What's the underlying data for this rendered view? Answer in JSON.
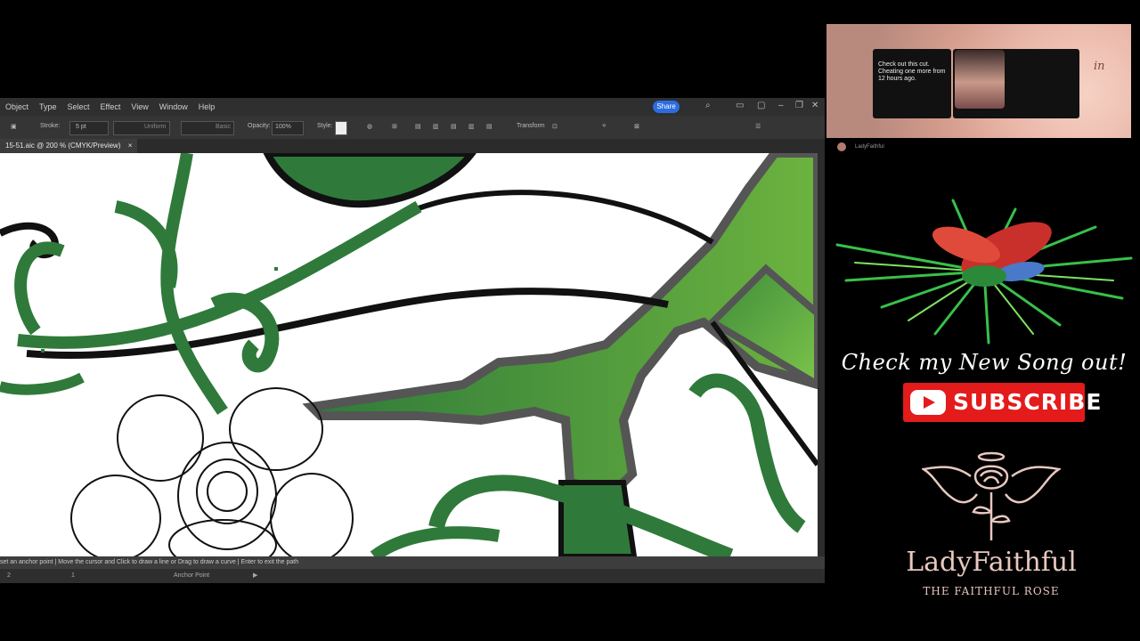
{
  "menu": {
    "items": [
      "Object",
      "Type",
      "Select",
      "Effect",
      "View",
      "Window",
      "Help"
    ],
    "share_label": "Share"
  },
  "control_bar": {
    "stroke_label": "Stroke:",
    "stroke_value": "5 pt",
    "profile_value": "Uniform",
    "brush_value": "Basic",
    "opacity_label": "Opacity:",
    "opacity_value": "100%",
    "style_label": "Style:",
    "transform_label": "Transform"
  },
  "document_tab": {
    "title": "15-51.aic @ 200 % (CMYK/Preview)",
    "close": "×"
  },
  "status_bar": {
    "hint": "set an anchor point  |  Move the cursor and Click to draw a line or Drag to draw a curve  |  Enter to exit the path"
  },
  "bottom_bar": {
    "zoom": "2",
    "page": "1",
    "tool": "Anchor Point"
  },
  "webcam": {
    "pv_text": "Check out this cut.\nCheating one more from 12 hours ago.",
    "owner_name": "LadyFaithful",
    "corner_text": "in"
  },
  "promo": {
    "headline": "Check my New Song out!",
    "subscribe": "SUBSCRIBE",
    "brand": "LadyFaithful",
    "tagline": "THE FAITHFUL ROSE"
  },
  "colors": {
    "green_dark": "#2f7a3a",
    "green_light": "#6cb33f",
    "youtube_red": "#e31b1b",
    "brand_tint": "#e8c8bf"
  }
}
